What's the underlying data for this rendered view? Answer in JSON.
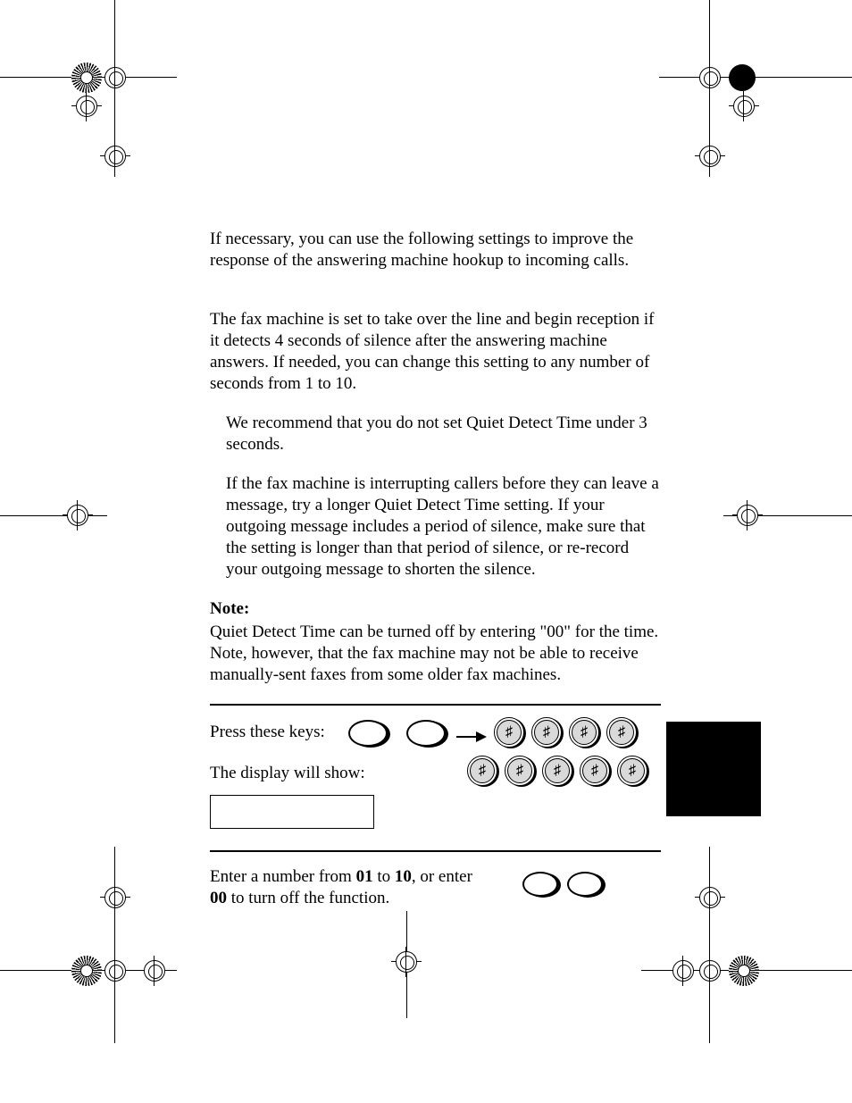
{
  "intro": "If necessary, you can use the following settings to improve the response of the answering machine hookup to incoming calls.",
  "desc": "The fax machine is set to take over the line and begin reception if it detects 4 seconds of silence after the answering machine answers. If needed, you can change this setting to any number of seconds from 1 to 10.",
  "bullet1": "We recommend that you do not set Quiet Detect Time under 3 seconds.",
  "bullet2": "If the fax machine is interrupting callers before they can leave a message, try a longer Quiet Detect Time setting. If your outgoing message includes a period of silence, make sure that the setting is longer than that period of silence, or re-record your outgoing message to shorten the silence.",
  "note_label": "Note:",
  "note_body": "Quiet Detect Time can be turned off by entering \"00\" for the time. Note, however, that the fax machine may not be able to receive manually-sent faxes from some older fax machines.",
  "step1_line1": "Press these keys:",
  "step1_line2": "The display will show:",
  "step2_a": "Enter a number from ",
  "step2_b": "01",
  "step2_c": " to ",
  "step2_d": "10",
  "step2_e": ", or enter ",
  "step2_f": "00",
  "step2_g": " to turn off the function."
}
